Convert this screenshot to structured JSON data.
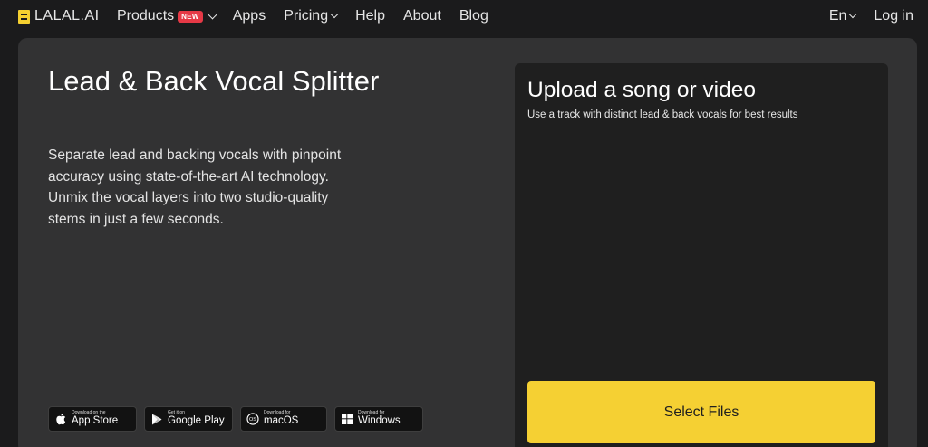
{
  "nav": {
    "logo_text": "LALAL.AI",
    "items": [
      {
        "label": "Products",
        "badge": "NEW"
      },
      {
        "label": "Apps"
      },
      {
        "label": "Pricing"
      },
      {
        "label": "Help"
      },
      {
        "label": "About"
      },
      {
        "label": "Blog"
      }
    ],
    "language": "En",
    "login": "Log in"
  },
  "hero": {
    "title": "Lead & Back Vocal Splitter",
    "description": "Separate lead and backing vocals with pinpoint accuracy using state-of-the-art AI technology. Unmix the vocal layers into two studio-quality stems in just a few seconds."
  },
  "stores": [
    {
      "small": "Download on the",
      "big": "App Store",
      "icon": "apple-icon"
    },
    {
      "small": "Get it on",
      "big": "Google Play",
      "icon": "google-play-icon"
    },
    {
      "small": "Download for",
      "big": "macOS",
      "icon": "macos-icon"
    },
    {
      "small": "Download for",
      "big": "Windows",
      "icon": "windows-icon"
    }
  ],
  "upload": {
    "title": "Upload a song or video",
    "subtitle": "Use a track with distinct lead & back vocals for best results",
    "button": "Select Files"
  },
  "colors": {
    "page_bg": "#1b1b1c",
    "card_bg": "#323233",
    "panel_bg": "#1f1f1f",
    "accent_yellow": "#f5d033",
    "badge_red": "#e63946"
  }
}
